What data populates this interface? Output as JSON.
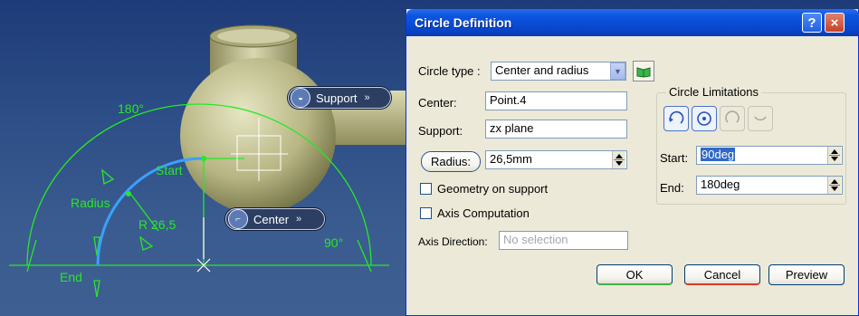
{
  "viewport": {
    "labels": {
      "angle_top": "180°",
      "start": "Start",
      "radius": "Radius",
      "radius_value": "R 26,5",
      "angle_right": "90°",
      "end": "End"
    },
    "tags": {
      "support": "Support",
      "center": "Center",
      "chevron": "»"
    },
    "colors": {
      "geometry": "#27e827",
      "arc": "#3aa0ff",
      "part": "#c7c69a"
    }
  },
  "dialog": {
    "title": "Circle Definition",
    "help_label": "?",
    "close_label": "×",
    "circle_type_label": "Circle type :",
    "circle_type_value": "Center and radius",
    "center_label": "Center:",
    "center_value": "Point.4",
    "support_label": "Support:",
    "support_value": "zx plane",
    "radius_button": "Radius:",
    "radius_value": "26,5mm",
    "geometry_on_support": "Geometry on support",
    "axis_computation": "Axis Computation",
    "axis_direction_label": "Axis Direction:",
    "axis_direction_placeholder": "No selection",
    "limitations": {
      "title": "Circle Limitations",
      "start_label": "Start:",
      "start_value": "90deg",
      "end_label": "End:",
      "end_value": "180deg",
      "icons": [
        "part-arc-icon",
        "whole-circle-icon",
        "trimmed-arc-icon",
        "complementary-arc-icon"
      ]
    },
    "ok": "OK",
    "cancel": "Cancel",
    "preview": "Preview"
  }
}
